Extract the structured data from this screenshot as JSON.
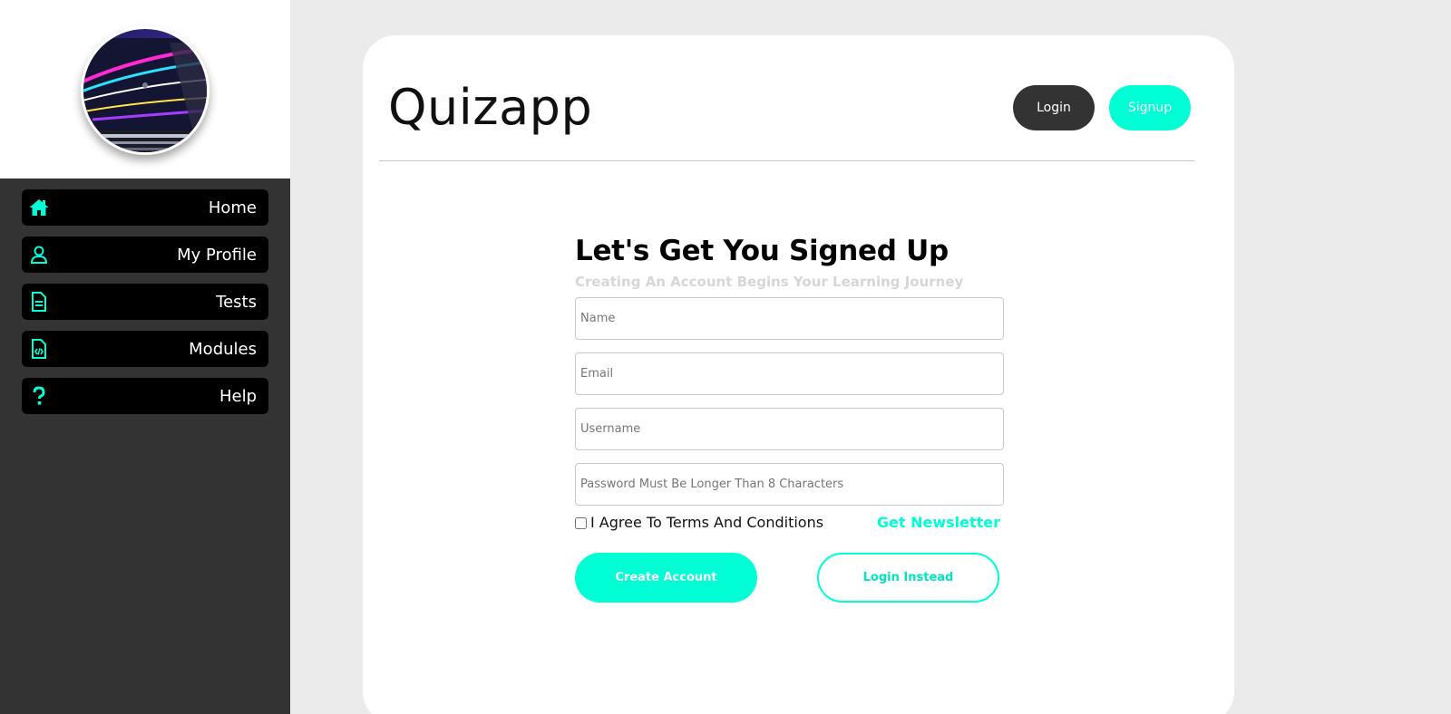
{
  "sidebar": {
    "avatar_icon": "laptop-avatar-image",
    "items": [
      {
        "label": "Home",
        "icon": "home-icon"
      },
      {
        "label": "My Profile",
        "icon": "user-icon"
      },
      {
        "label": "Tests",
        "icon": "document-icon"
      },
      {
        "label": "Modules",
        "icon": "code-file-icon"
      },
      {
        "label": "Help",
        "icon": "question-icon"
      }
    ]
  },
  "header": {
    "brand": "Quizapp",
    "login_label": "Login",
    "signup_label": "Signup"
  },
  "form": {
    "title": "Let's Get You Signed Up",
    "subtitle": "Creating An Account Begins Your Learning Journey",
    "name_placeholder": "Name",
    "email_placeholder": "Email",
    "username_placeholder": "Username",
    "password_placeholder": "Password Must Be Longer Than 8 Characters",
    "terms_label": "I Agree To Terms And Conditions",
    "terms_checked": false,
    "newsletter_label": "Get Newsletter",
    "create_label": "Create Account",
    "login_instead_label": "Login Instead"
  },
  "colors": {
    "accent": "#00ffd5",
    "sidebar_bg": "#333333",
    "nav_bg": "#000000",
    "page_bg": "#ebebeb"
  }
}
